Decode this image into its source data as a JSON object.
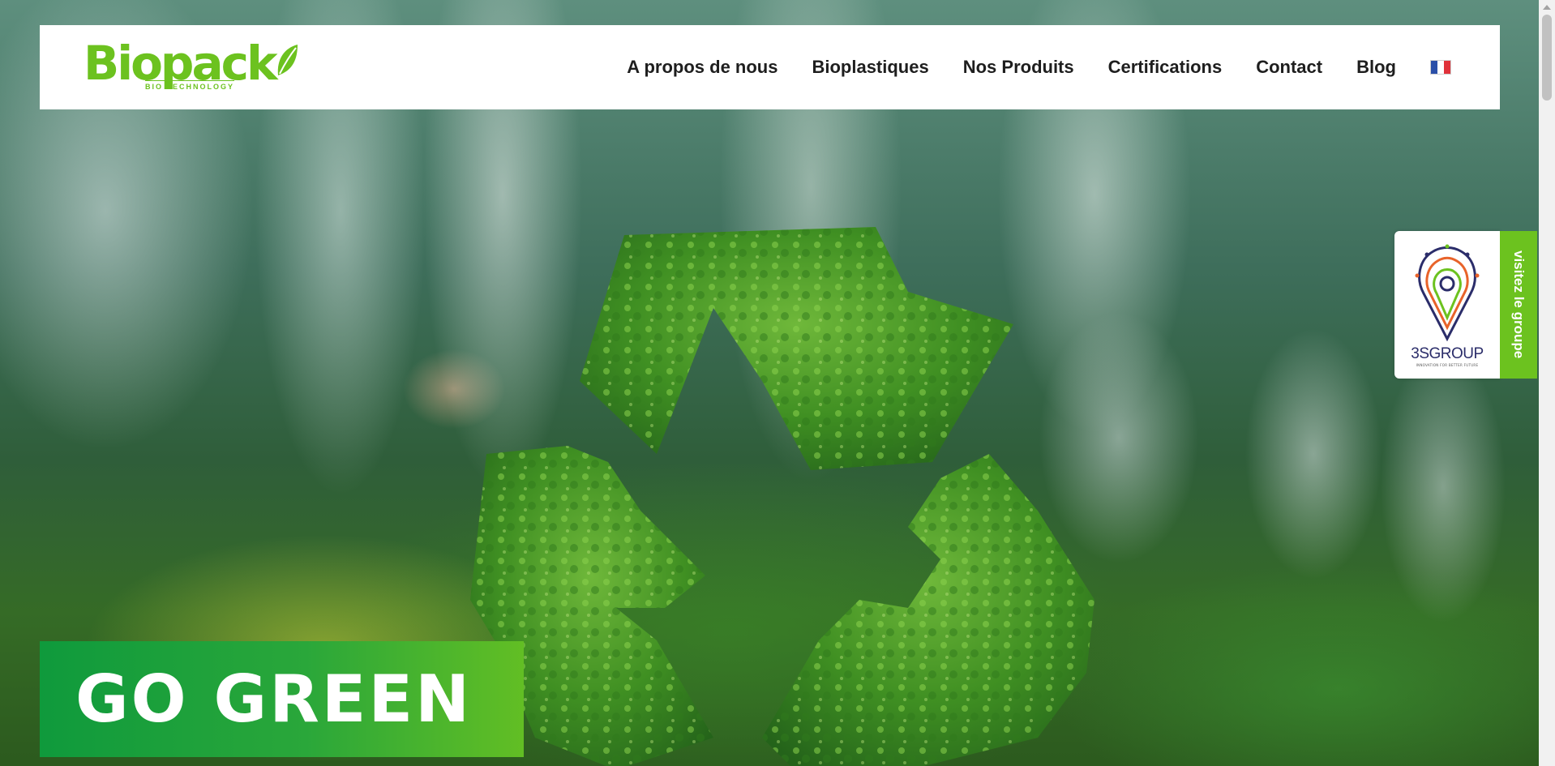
{
  "brand": {
    "name": "Biopack",
    "subtitle": "BIO TECHNOLOGY",
    "color": "#6cc21f"
  },
  "nav": {
    "items": [
      {
        "label": "A propos de nous"
      },
      {
        "label": "Bioplastiques"
      },
      {
        "label": "Nos Produits"
      },
      {
        "label": "Certifications"
      },
      {
        "label": "Contact"
      },
      {
        "label": "Blog"
      }
    ],
    "language_icon": "french-flag-icon"
  },
  "side_widget": {
    "group_name": "3SGROUP",
    "tagline": "INNOVATION FOR BETTER FUTURE",
    "tab_label": "visitez le groupe"
  },
  "hero": {
    "banner_text": "GO GREEN",
    "banner_gradient_start": "#0f9a3c",
    "banner_gradient_end": "#62be24"
  }
}
